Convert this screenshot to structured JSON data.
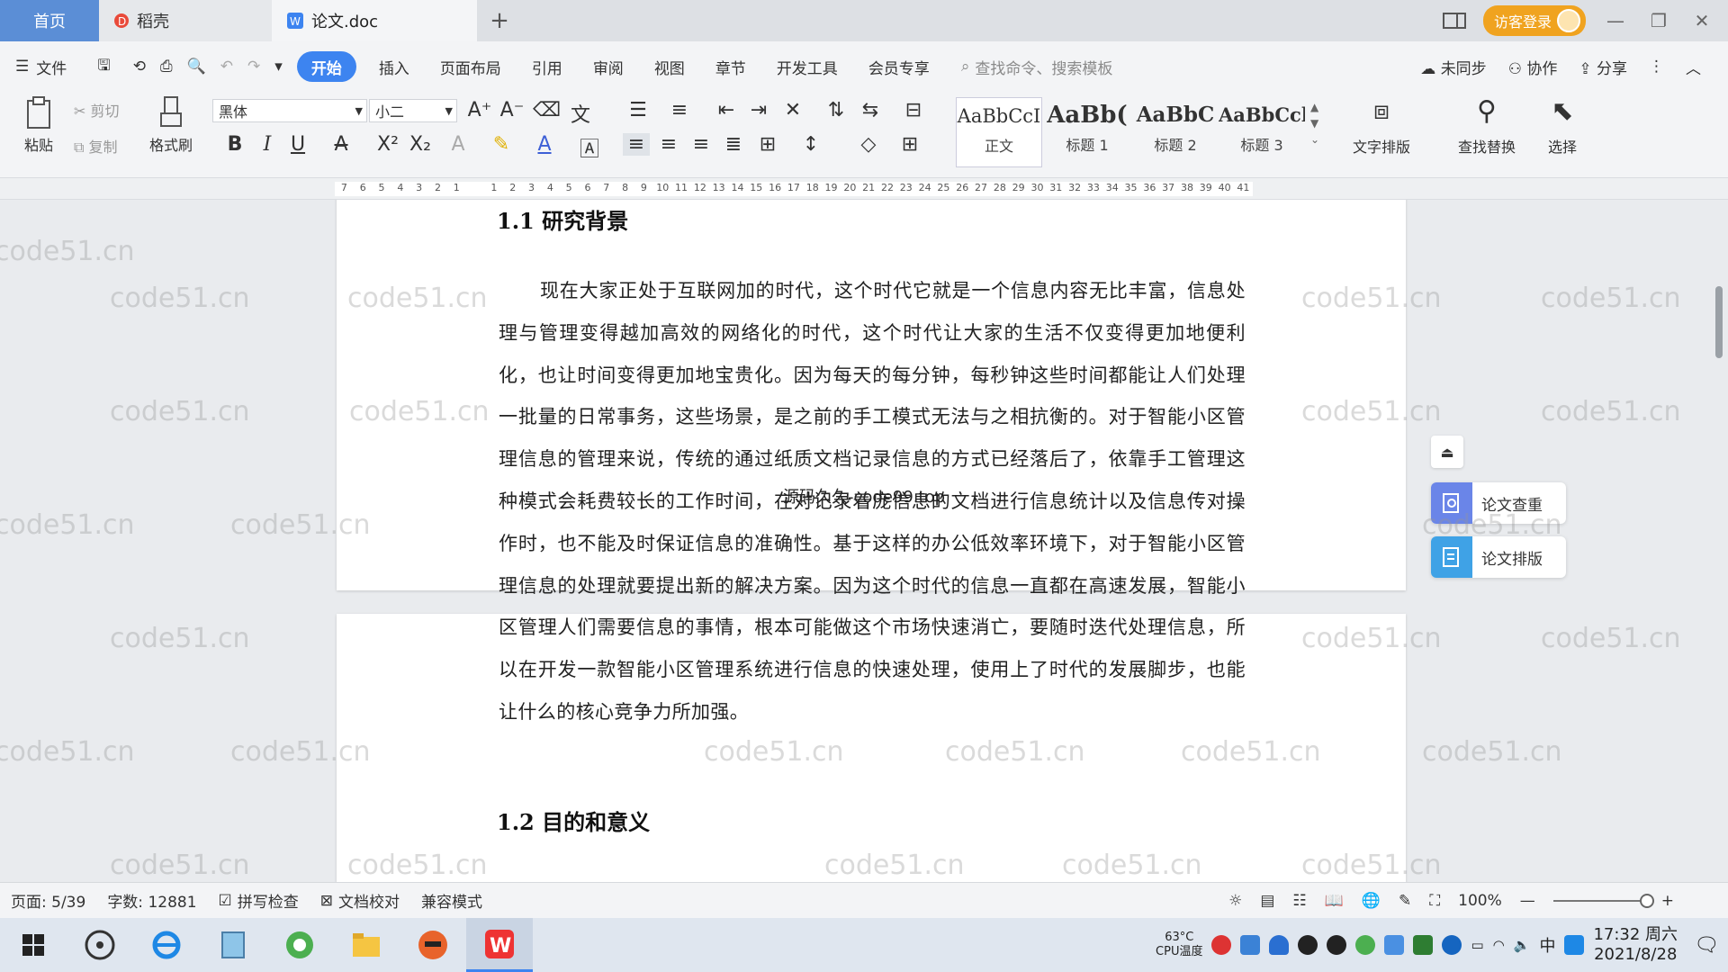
{
  "titlebar": {
    "tabs": [
      {
        "label": "首页"
      },
      {
        "label": "稻壳"
      },
      {
        "label": "论文.doc"
      }
    ],
    "login_label": "访客登录"
  },
  "menubar": {
    "file_label": "文件",
    "items": [
      "开始",
      "插入",
      "页面布局",
      "引用",
      "审阅",
      "视图",
      "章节",
      "开发工具",
      "会员专享"
    ],
    "search_placeholder": "查找命令、搜索模板",
    "sync_label": "未同步",
    "collab_label": "协作",
    "share_label": "分享"
  },
  "ribbon": {
    "paste_label": "粘贴",
    "cut_label": "剪切",
    "copy_label": "复制",
    "format_painter_label": "格式刷",
    "font_name": "黑体",
    "font_size": "小二",
    "styles": [
      {
        "sample": "AaBbCcI",
        "label": "正文"
      },
      {
        "sample": "AaBb(",
        "label": "标题 1"
      },
      {
        "sample": "AaBbC",
        "label": "标题 2"
      },
      {
        "sample": "AaBbCcl",
        "label": "标题 3"
      }
    ],
    "text_layout_label": "文字排版",
    "find_replace_label": "查找替换",
    "select_label": "选择"
  },
  "ruler": {
    "ticks": [
      "7",
      "6",
      "5",
      "4",
      "3",
      "2",
      "1",
      "",
      "1",
      "2",
      "3",
      "4",
      "5",
      "6",
      "7",
      "8",
      "9",
      "10",
      "11",
      "12",
      "13",
      "14",
      "15",
      "16",
      "17",
      "18",
      "19",
      "20",
      "21",
      "22",
      "23",
      "24",
      "25",
      "26",
      "27",
      "28",
      "29",
      "30",
      "31",
      "32",
      "33",
      "34",
      "35",
      "36",
      "37",
      "38",
      "39",
      "40",
      "41"
    ]
  },
  "document": {
    "heading_1_1": "1.1 研究背景",
    "paragraph_1": "现在大家正处于互联网加的时代，这个时代它就是一个信息内容无比丰富，信息处理与管理变得越加高效的网络化的时代，这个时代让大家的生活不仅变得更加地便利化，也让时间变得更加地宝贵化。因为每天的每分钟，每秒钟这些时间都能让人们处理一批量的日常事务，这些场景，是之前的手工模式无法与之相抗衡的。对于智能小区管理信息的管理来说，传统的通过纸质文档记录信息的方式已经落后了，依靠手工管理这种模式会耗费较长的工作时间，在对记录着庞信息的文档进行信息统计以及信息传对操作时，也不能及时保证信息的准确性。基于这样的办公低效率环境下，对于智能小区管理信息的处理就要提出新的解决方案。因为这个时代的信息一直都在高速发展，智能小区管理人们需要信息的事情，根本可能做这个市场快速消亡，要随时迭代处理信息，所以在开发一款智能小区管理系统进行信息的快速处理，使用上了时代的发展脚步，也能让什么的核心竞争力所加强。",
    "heading_1_2": "1.2 目的和意义",
    "overlay_text": "源码久久-code99.top"
  },
  "side_panel": {
    "check_label": "论文查重",
    "layout_label": "论文排版"
  },
  "watermark_text": "code51.cn",
  "statusbar": {
    "page_info": "页面: 5/39",
    "word_count": "字数: 12881",
    "spell_check": "拼写检查",
    "doc_proofread": "文档校对",
    "compat_mode": "兼容模式",
    "zoom": "100%"
  },
  "taskbar": {
    "cpu_temp": "63°C",
    "cpu_label": "CPU温度",
    "ime": "中",
    "time": "17:32 周六",
    "date": "2021/8/28"
  },
  "colors": {
    "accent": "#3d84f0",
    "home_tab": "#5b8ed6",
    "login": "#f0a31f",
    "side_icon": "#6a85e8"
  }
}
